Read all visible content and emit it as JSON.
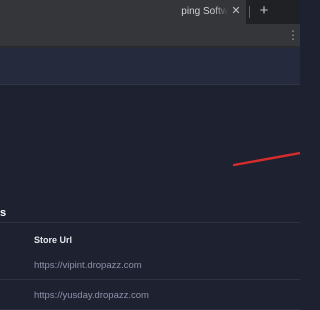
{
  "browser": {
    "tab_title": "ping Softw",
    "tab_close_glyph": "✕",
    "new_tab_glyph": "+",
    "toolbar_menu_glyph": "⋮"
  },
  "table": {
    "section_title": "s",
    "column_header": "Store Url",
    "rows": [
      {
        "store_url": "https://vipint.dropazz.com"
      },
      {
        "store_url": "https://yusday.dropazz.com"
      }
    ]
  },
  "annotation": {
    "arrow_icon": "red-arrow-icon",
    "color": "#d62c2c"
  },
  "colors": {
    "background": "#1e2130",
    "header": "#262a3d",
    "tab": "#35363a"
  }
}
